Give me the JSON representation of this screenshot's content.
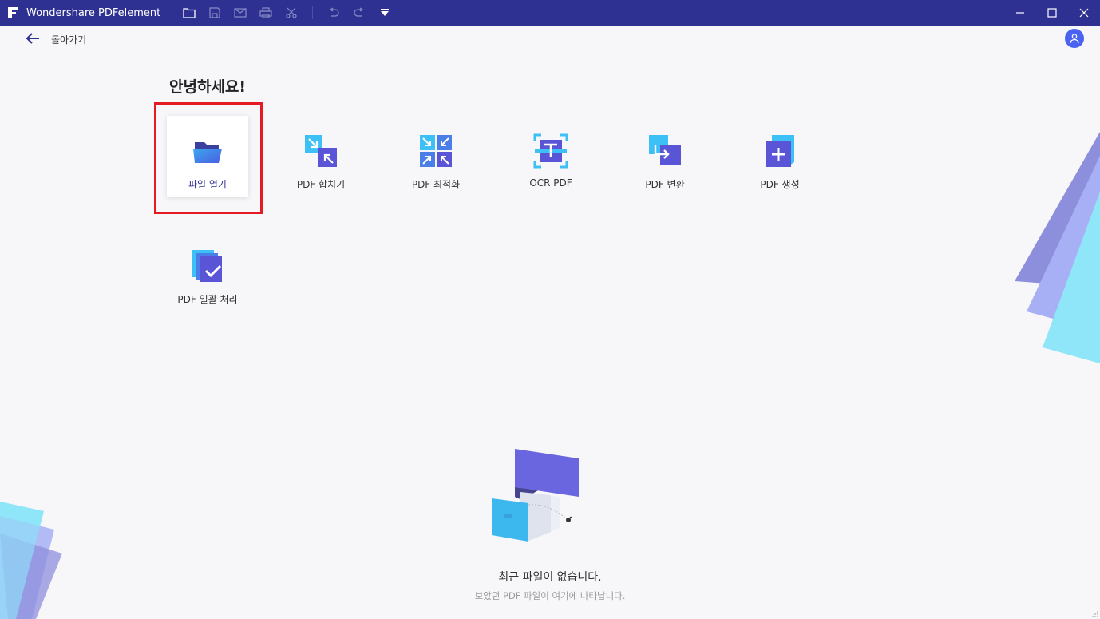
{
  "app": {
    "title": "Wondershare PDFelement",
    "accent_color": "#2e3191",
    "highlight_color": "#e41b23"
  },
  "toolbar": {
    "icons": [
      "open-folder-icon",
      "save-icon",
      "mail-icon",
      "print-icon",
      "scissors-icon",
      "undo-icon",
      "redo-icon",
      "dropdown-icon"
    ]
  },
  "window_controls": [
    "minimize-icon",
    "maximize-icon",
    "close-icon"
  ],
  "nav": {
    "back_label": "돌아가기"
  },
  "home": {
    "greeting": "안녕하세요!",
    "tiles": [
      {
        "label": "파일 열기",
        "icon": "open-folder-icon",
        "selected": true
      },
      {
        "label": "PDF 합치기",
        "icon": "merge-icon"
      },
      {
        "label": "PDF 최적화",
        "icon": "optimize-icon"
      },
      {
        "label": "OCR PDF",
        "icon": "ocr-icon"
      },
      {
        "label": "PDF 변환",
        "icon": "convert-icon"
      },
      {
        "label": "PDF 생성",
        "icon": "create-icon"
      },
      {
        "label": "PDF 일괄 처리",
        "icon": "batch-icon"
      }
    ]
  },
  "recent": {
    "empty_title": "최근 파일이 없습니다.",
    "empty_subtitle": "보았던 PDF 파일이 여기에 나타납니다."
  }
}
